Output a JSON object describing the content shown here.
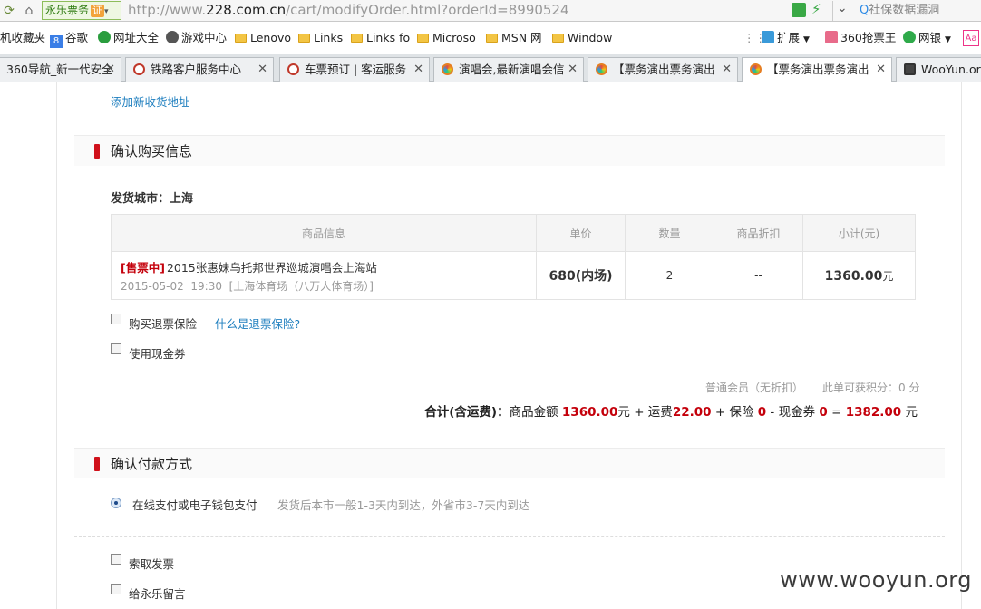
{
  "browser": {
    "site_badge": "永乐票务",
    "site_cert": "证",
    "url_prefix": "http://www.",
    "url_host": "228.com.cn",
    "url_path": "/cart/modifyOrder.html?orderId=8990524",
    "search_text": "社保数据漏洞"
  },
  "bookmarks": [
    {
      "label": "机收藏夹"
    },
    {
      "label": "谷歌"
    },
    {
      "label": "网址大全"
    },
    {
      "label": "游戏中心"
    },
    {
      "label": "Lenovo"
    },
    {
      "label": "Links"
    },
    {
      "label": "Links fo"
    },
    {
      "label": "Microso"
    },
    {
      "label": "MSN 网"
    },
    {
      "label": "Window"
    }
  ],
  "bookmarks_right": {
    "extend": "扩展",
    "qiangpiao": "360抢票王",
    "wangyin": "网银"
  },
  "tabs": [
    {
      "label": "360导航_新一代安全"
    },
    {
      "label": "铁路客户服务中心"
    },
    {
      "label": "车票预订 | 客运服务"
    },
    {
      "label": "演唱会,最新演唱会信"
    },
    {
      "label": "【票务演出票务演出"
    },
    {
      "label": "【票务演出票务演出"
    },
    {
      "label": "WooYun.or"
    }
  ],
  "page": {
    "add_address": "添加新收货地址",
    "section_confirm": "确认购买信息",
    "ship_city": "发货城市：上海",
    "table": {
      "headers": [
        "商品信息",
        "单价",
        "数量",
        "商品折扣",
        "小计(元)"
      ],
      "status": "[售票中]",
      "name": "2015张惠妹乌托邦世界巡城演唱会上海站",
      "date": "2015-05-02",
      "time": "19:30",
      "venue": "[上海体育场（八万人体育场）]",
      "price": "680(内场)",
      "qty": "2",
      "discount": "--",
      "subtotal": "1360.00",
      "subtotal_unit": "元"
    },
    "insurance_label": "购买退票保险",
    "insurance_link": "什么是退票保险?",
    "voucher_label": "使用现金券",
    "member_info": "普通会员（无折扣）",
    "points_info": "此单可获积分：0 分",
    "total": {
      "label": "合计(含运费)：",
      "goods_label": "商品金额",
      "goods_amount": "1360.00",
      "yuan": "元",
      "plus1": "+ 运费",
      "shipping": "22.00",
      "plus2": "+ 保险",
      "insurance": "0",
      "minus": "- 现金券",
      "voucher": "0",
      "equals": "=",
      "grand": "1382.00",
      "yuan2": "元"
    },
    "section_payment": "确认付款方式",
    "pay_option": "在线支付或电子钱包支付",
    "pay_note": "发货后本市一般1-3天内到达，外省市3-7天内到达",
    "invoice_label": "索取发票",
    "message_label": "给永乐留言"
  },
  "watermark": "www.wooyun.org"
}
